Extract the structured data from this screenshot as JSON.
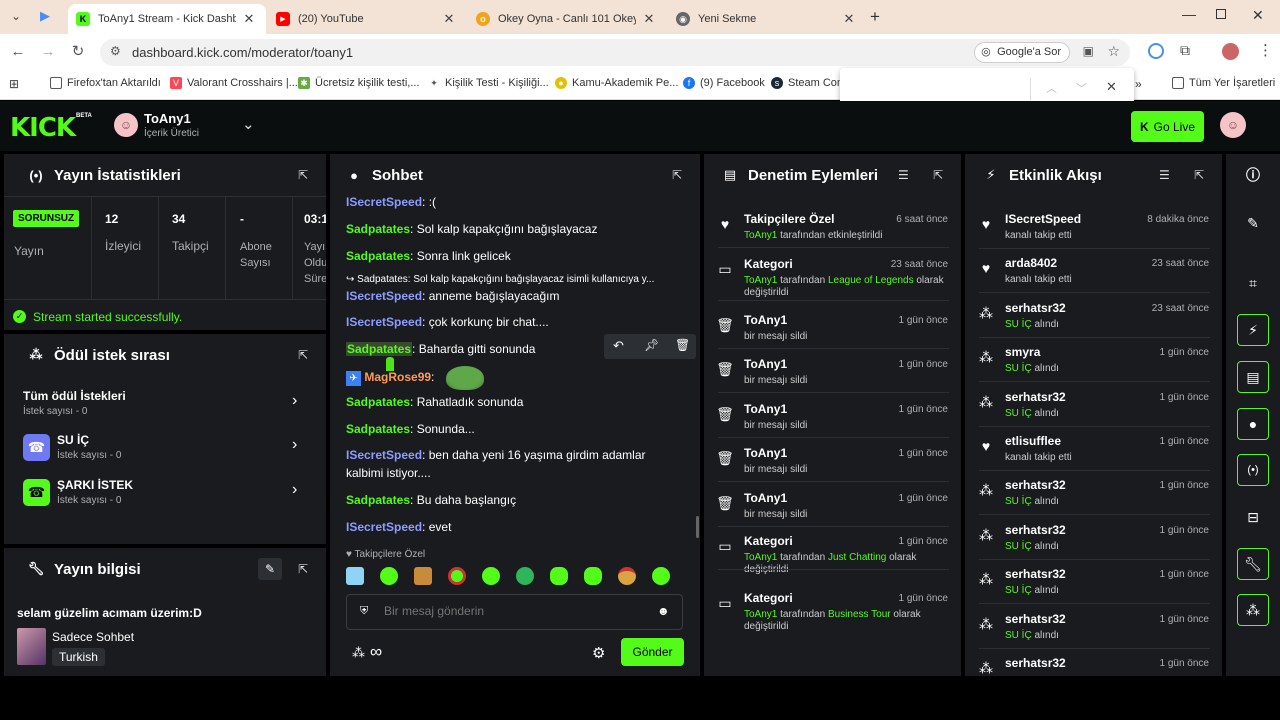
{
  "browser": {
    "tabs": [
      {
        "label": "ToAny1 Stream - Kick Dashboar",
        "active": true
      },
      {
        "label": "(20) YouTube"
      },
      {
        "label": "Okey Oyna - Canlı 101 Okey ve"
      },
      {
        "label": "Yeni Sekme"
      }
    ],
    "url": "dashboard.kick.com/moderator/toany1",
    "google_ask": "Google'a Sor",
    "bookmarks": [
      "Firefox'tan Aktarıldı",
      "Valorant Crosshairs |...",
      "Ücretsiz kişilik testi,...",
      "Kişilik Testi - Kişiliği...",
      "Kamu-Akademik Pe...",
      "(9) Facebook",
      "Steam Com"
    ],
    "bookmark_all": "Tüm Yer İşaretleri"
  },
  "header": {
    "logo": "KICK",
    "beta": "BETA",
    "user_name": "ToAny1",
    "user_role": "İçerik Üretici",
    "go_live": "Go Live"
  },
  "stats": {
    "title": "Yayın İstatistikleri",
    "status_badge": "SORUNSUZ",
    "status_label": "Yayın",
    "viewers_value": "12",
    "viewers_label": "İzleyici",
    "followers_value": "34",
    "followers_label": "Takipçi",
    "subs_value": "-",
    "subs_label": "Abone Sayısı",
    "time_value": "03:1",
    "time_label": "Yayı Oldu Süre",
    "success_msg": "Stream started successfully."
  },
  "rewards": {
    "title": "Ödül istek sırası",
    "items": [
      {
        "name": "Tüm ödül İstekleri",
        "count": "İstek sayısı - 0"
      },
      {
        "name": "SU İÇ",
        "count": "İstek sayısı - 0"
      },
      {
        "name": "ŞARKI İSTEK",
        "count": "İstek sayısı - 0"
      }
    ]
  },
  "stream_info": {
    "title": "Yayın bilgisi",
    "stream_title": "selam güzelim acımam üzerim:D",
    "category": "Sadece Sohbet",
    "language": "Turkish"
  },
  "chat": {
    "title": "Sohbet",
    "messages": [
      {
        "user": "ISecretSpeed",
        "text": ": :("
      },
      {
        "user": "Sadpatates",
        "text": ": Sol kalp kapakçığını bağışlayacaz"
      },
      {
        "user": "Sadpatates",
        "text": ": Sonra link gelicek"
      },
      {
        "reply": "Sadpatates: Sol kalp kapakçığını bağışlayacaz isimli kullanıcıya y..."
      },
      {
        "user": "ISecretSpeed",
        "text": ": anneme bağışlayacağım"
      },
      {
        "user": "ISecretSpeed",
        "text": ": çok korkunç bir chat...."
      },
      {
        "user": "Sadpatates",
        "text": ": Baharda gitti sonunda"
      },
      {
        "user": "MagRose99",
        "text": ":"
      },
      {
        "user": "Sadpatates",
        "text": ": Rahatladık sonunda"
      },
      {
        "user": "Sadpatates",
        "text": ": Sonunda..."
      },
      {
        "user": "ISecretSpeed",
        "text": ": ben daha yeni 16 yaşıma girdim adamlar kalbimi istiyor...."
      },
      {
        "user": "Sadpatates",
        "text": ": Bu daha başlangıç"
      },
      {
        "user": "ISecretSpeed",
        "text": ": evet"
      }
    ],
    "followers_only": "Takipçilere Özel",
    "placeholder": "Bir mesaj gönderin",
    "send": "Gönder"
  },
  "moderation": {
    "title": "Denetim Eylemleri",
    "items": [
      {
        "icon": "heart-icon",
        "title": "Takipçilere Özel",
        "time": "6 saat önce",
        "actor": "ToAny1",
        "line": " tarafından etkinleştirildi"
      },
      {
        "icon": "category-icon",
        "title": "Kategori",
        "time": "23 saat önce",
        "actor": "ToAny1",
        "line": " tarafından ",
        "value": "League of Legends",
        "line2": " olarak değiştirildi"
      },
      {
        "icon": "trash-icon",
        "title": "ToAny1",
        "time": "1 gün önce",
        "line": "bir mesajı sildi"
      },
      {
        "icon": "trash-icon",
        "title": "ToAny1",
        "time": "1 gün önce",
        "line": "bir mesajı sildi"
      },
      {
        "icon": "trash-icon",
        "title": "ToAny1",
        "time": "1 gün önce",
        "line": "bir mesajı sildi"
      },
      {
        "icon": "trash-icon",
        "title": "ToAny1",
        "time": "1 gün önce",
        "line": "bir mesajı sildi"
      },
      {
        "icon": "trash-icon",
        "title": "ToAny1",
        "time": "1 gün önce",
        "line": "bir mesajı sildi"
      },
      {
        "icon": "category-icon",
        "title": "Kategori",
        "time": "1 gün önce",
        "actor": "ToAny1",
        "line": " tarafından ",
        "value": "Just Chatting",
        "line2": " olarak değiştirildi"
      },
      {
        "icon": "category-icon",
        "title": "Kategori",
        "time": "1 gün önce",
        "actor": "ToAny1",
        "line": " tarafından ",
        "value": "Business Tour",
        "line2": " olarak değiştirildi"
      }
    ]
  },
  "activity": {
    "title": "Etkinlik Akışı",
    "items": [
      {
        "icon": "heart-icon",
        "name": "ISecretSpeed",
        "time": "8 dakika önce",
        "line": "kanalı takip etti"
      },
      {
        "icon": "heart-icon",
        "name": "arda8402",
        "time": "23 saat önce",
        "line": "kanalı takip etti"
      },
      {
        "icon": "reward-icon",
        "name": "serhatsr32",
        "time": "23 saat önce",
        "reward": "SU İÇ",
        "line": " alındı"
      },
      {
        "icon": "reward-icon",
        "name": "smyra",
        "time": "1 gün önce",
        "reward": "SU İÇ",
        "line": " alındı"
      },
      {
        "icon": "reward-icon",
        "name": "serhatsr32",
        "time": "1 gün önce",
        "reward": "SU İÇ",
        "line": " alındı"
      },
      {
        "icon": "heart-icon",
        "name": "etlisufflee",
        "time": "1 gün önce",
        "line": "kanalı takip etti"
      },
      {
        "icon": "reward-icon",
        "name": "serhatsr32",
        "time": "1 gün önce",
        "reward": "SU İÇ",
        "line": " alındı"
      },
      {
        "icon": "reward-icon",
        "name": "serhatsr32",
        "time": "1 gün önce",
        "reward": "SU İÇ",
        "line": " alındı"
      },
      {
        "icon": "reward-icon",
        "name": "serhatsr32",
        "time": "1 gün önce",
        "reward": "SU İÇ",
        "line": " alındı"
      },
      {
        "icon": "reward-icon",
        "name": "serhatsr32",
        "time": "1 gün önce",
        "reward": "SU İÇ",
        "line": " alındı"
      },
      {
        "icon": "reward-icon",
        "name": "serhatsr32",
        "time": "1 gün önce"
      }
    ]
  },
  "colors": {
    "brand": "#53fc18",
    "panel": "#191b1f",
    "bg": "#000000",
    "user_blue": "#8f9cff",
    "user_orange": "#ff9a5a"
  }
}
